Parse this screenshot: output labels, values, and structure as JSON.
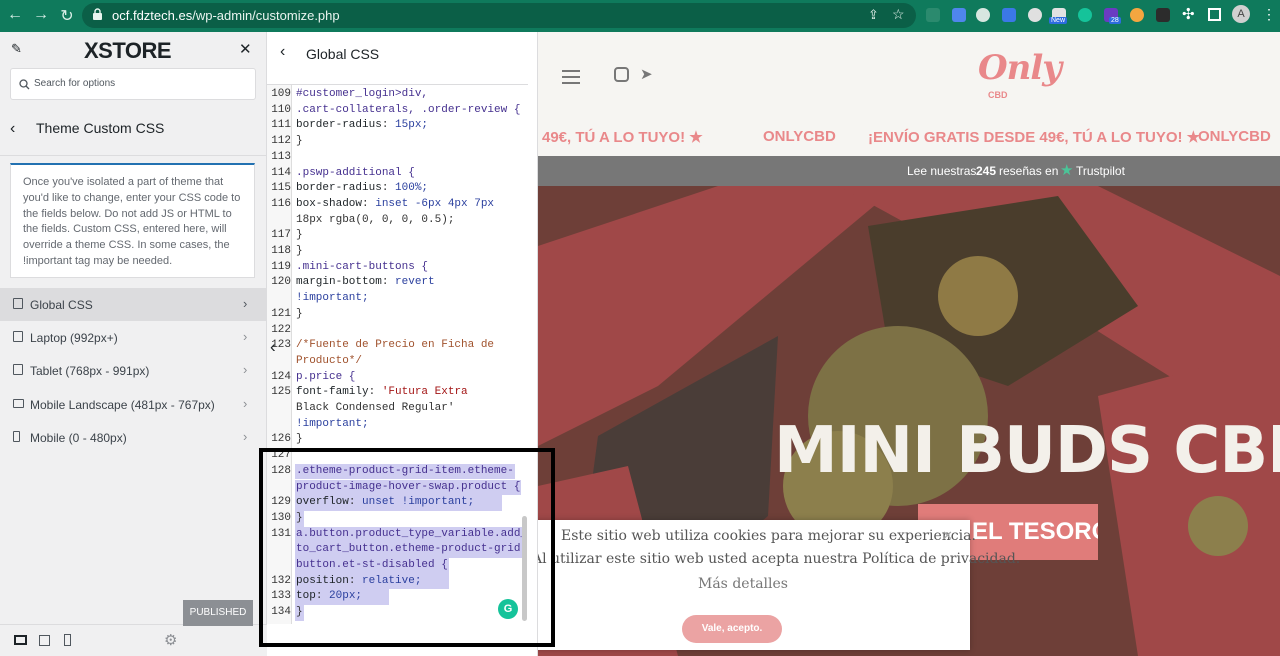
{
  "browser": {
    "url_domain": "ocf.fdztech.es",
    "url_path": "/wp-admin/customize.php",
    "ext_badges": {
      "new": "New",
      "count": "28"
    },
    "profile_initial": "A"
  },
  "sidebar": {
    "logo": "XSTORE",
    "search_placeholder": "Search for options",
    "section_title": "Theme Custom CSS",
    "description": "Once you've isolated a part of theme that you'd like to change, enter your CSS code to the fields below. Do not add JS or HTML to the fields. Custom CSS, entered here, will override a theme CSS. In some cases, the !important tag may be needed.",
    "items": [
      {
        "label": "Global CSS",
        "icon": "desktop-icon"
      },
      {
        "label": "Laptop (992px+)",
        "icon": "laptop-icon"
      },
      {
        "label": "Tablet (768px - 991px)",
        "icon": "tablet-icon"
      },
      {
        "label": "Mobile Landscape (481px - 767px)",
        "icon": "landscape-icon"
      },
      {
        "label": "Mobile (0 - 480px)",
        "icon": "mobile-icon"
      }
    ],
    "publish_label": "PUBLISHED"
  },
  "css_panel": {
    "title": "Global CSS",
    "gutter": [
      "109",
      "110",
      "111",
      "112",
      "113",
      "114",
      "115",
      "116",
      "",
      "117",
      "118",
      "119",
      "120",
      "",
      "121",
      "122",
      "123",
      "",
      "124",
      "125",
      "",
      "",
      "126",
      "127",
      "128",
      "",
      "129",
      "130",
      "131",
      "",
      "",
      "132",
      "133",
      "134"
    ],
    "code": [
      "#customer_login>div,",
      ".cart-collaterals, .order-review {",
      "    border-radius: 15px;",
      "}",
      "",
      ".pswp-additional {",
      "  border-radius: 100%;",
      "  box-shadow: inset -6px 4px 7px",
      "18px rgba(0, 0, 0, 0.5);",
      "}",
      "}",
      ".mini-cart-buttons {",
      "    margin-bottom: revert",
      "!important;",
      "}",
      "",
      "/*Fuente de Precio en Ficha de",
      "Producto*/",
      "p.price {",
      "    font-family: 'Futura Extra",
      "Black Condensed Regular'",
      "!important;",
      "}",
      "",
      ".etheme-product-grid-item.etheme-",
      "product-image-hover-swap.product {",
      "    overflow: unset !important;",
      "}",
      "a.button.product_type_variable.add_",
      "to_cart_button.etheme-product-grid-",
      "button.et-st-disabled {",
      "    position: relative;",
      "    top: 20px;",
      "}"
    ]
  },
  "preview": {
    "logo_main": "Only",
    "logo_sub": "CBD",
    "marquee": [
      "49€, TÚ A LO TUYO! ★",
      "ONLYCBD",
      "¡ENVÍO GRATIS DESDE 49€, TÚ A LO TUYO! ★",
      "ONLYCBD"
    ],
    "trustpilot_prefix": "Lee nuestras",
    "trustpilot_count": "245",
    "trustpilot_mid": "reseñas en",
    "trustpilot_brand": "Trustpilot",
    "hero_title": "MINI BUDS CBD",
    "hero_button": "R EL TESORO",
    "cookie_line1": "Este sitio web utiliza cookies para mejorar su experiencia.",
    "cookie_line2": "Al utilizar este sitio web usted acepta nuestra Política de privacidad.",
    "cookie_more": "Más detalles",
    "cookie_ok": "Vale, acepto."
  }
}
